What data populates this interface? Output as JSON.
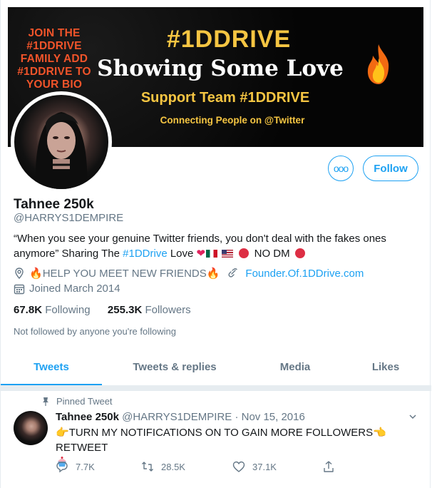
{
  "banner": {
    "left_text": "JOIN THE #1DDRIVE FAMILY ADD #1DDRIVE TO YOUR BIO",
    "hashtag": "#1DDRIVE",
    "headline": "Showing Some Love",
    "support": "Support Team #1DDRIVE",
    "connecting": "Connecting People on @Twitter"
  },
  "profile": {
    "more_icon": "ooo",
    "follow_label": "Follow",
    "name": "Tahnee 250k",
    "handle": "@HARRYS1DEMPIRE",
    "bio_part1": "“When you see your genuine Twitter friends, you don't deal with the fakes ones anymore” Sharing The ",
    "bio_tag": "#1DDrive",
    "bio_part2": " Love ",
    "bio_end": " NO DM ",
    "location": "HELP YOU MEET NEW FRIENDS",
    "website": "Founder.Of.1DDrive.com",
    "joined": "Joined March 2014",
    "following_count": "67.8K",
    "following_label": "Following",
    "followers_count": "255.3K",
    "followers_label": "Followers",
    "not_followed": "Not followed by anyone you're following"
  },
  "tabs": [
    {
      "label": "Tweets"
    },
    {
      "label": "Tweets & replies"
    },
    {
      "label": "Media"
    },
    {
      "label": "Likes"
    }
  ],
  "tweet": {
    "pinned_label": "Pinned Tweet",
    "name": "Tahnee 250k",
    "handle_date": "@HARRYS1DEMPIRE · Nov 15, 2016",
    "text": "TURN MY NOTIFICATIONS ON TO GAIN MORE FOLLOWERS",
    "text_end": " RETWEET",
    "replies": "7.7K",
    "retweets": "28.5K",
    "likes": "37.1K"
  },
  "colors": {
    "accent": "#1da1f2",
    "secondary_text": "#657786",
    "banner_gold": "#f5c542",
    "banner_orange": "#f0542a"
  }
}
